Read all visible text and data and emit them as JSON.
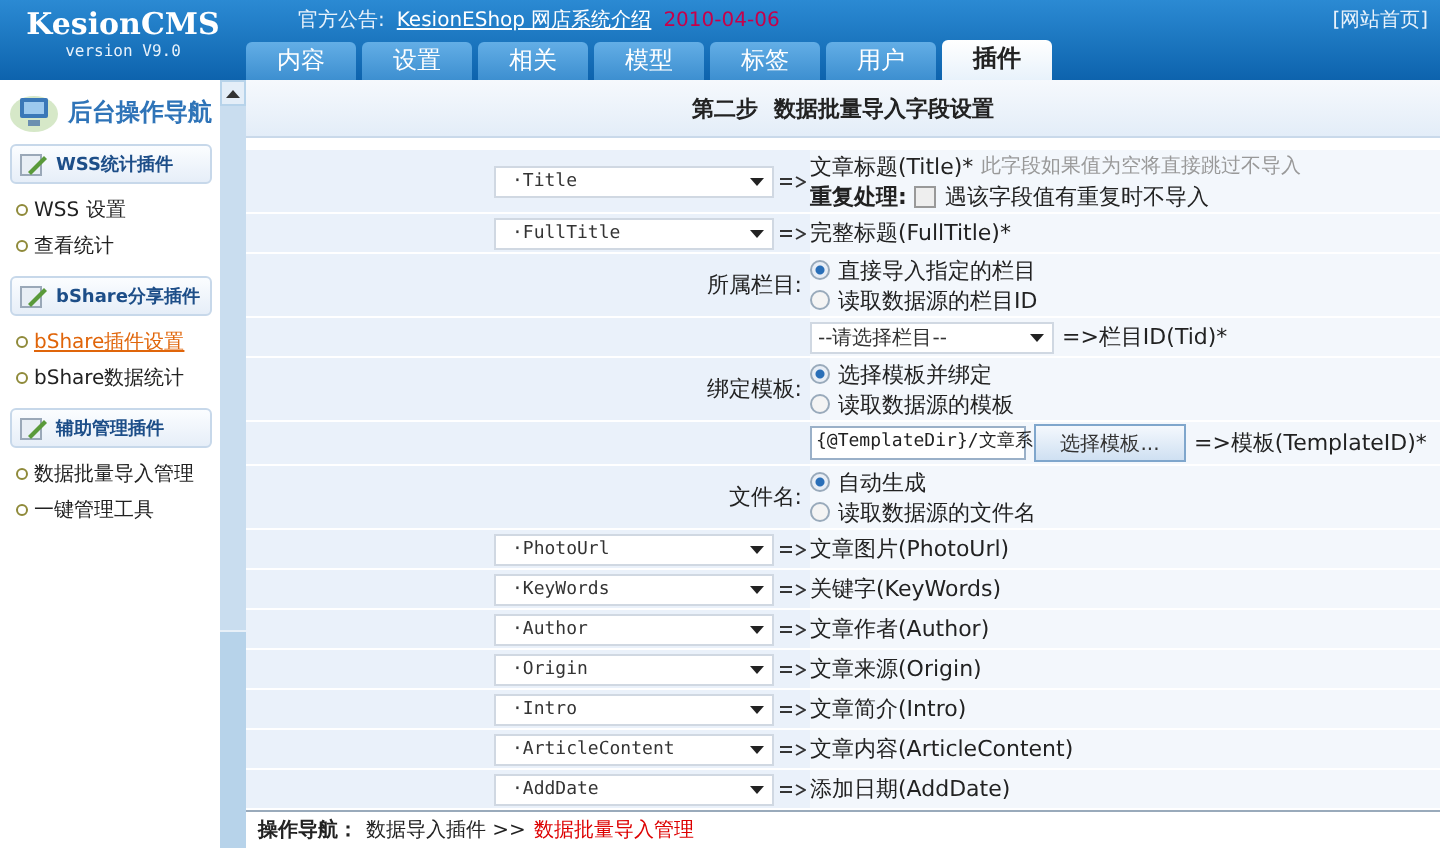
{
  "header": {
    "logo": "KesionCMS",
    "version": "version V9.0",
    "notice_label": "官方公告:",
    "notice_link": "KesionEShop 网店系统介绍",
    "notice_date": "2010-04-06",
    "top_link": "[网站首页]"
  },
  "tabs": [
    {
      "label": "内容",
      "selected": false
    },
    {
      "label": "设置",
      "selected": false
    },
    {
      "label": "相关",
      "selected": false
    },
    {
      "label": "模型",
      "selected": false
    },
    {
      "label": "标签",
      "selected": false
    },
    {
      "label": "用户",
      "selected": false
    },
    {
      "label": "插件",
      "selected": true
    }
  ],
  "sidebar": {
    "title": "后台操作导航",
    "groups": [
      {
        "title": "WSS统计插件",
        "items": [
          {
            "label": "WSS 设置",
            "selected": false
          },
          {
            "label": "查看统计",
            "selected": false
          }
        ]
      },
      {
        "title": "bShare分享插件",
        "items": [
          {
            "label": "bShare插件设置",
            "selected": true
          },
          {
            "label": "bShare数据统计",
            "selected": false
          }
        ]
      },
      {
        "title": "辅助管理插件",
        "items": [
          {
            "label": "数据批量导入管理",
            "selected": false
          },
          {
            "label": "一键管理工具",
            "selected": false
          }
        ]
      }
    ]
  },
  "step_title": "第二步  数据批量导入字段设置",
  "rows": [
    {
      "kind": "field_map",
      "field": "·Title",
      "target": "文章标题(Title)*",
      "note": "此字段如果值为空将直接跳过不导入",
      "extra": {
        "label": "重复处理:",
        "checkbox_label": "遇该字段值有重复时不导入",
        "checked": false
      }
    },
    {
      "kind": "field_map",
      "field": "·FullTitle",
      "target": "完整标题(FullTitle)*"
    },
    {
      "kind": "radio",
      "label": "所属栏目:",
      "options": [
        {
          "label": "直接导入指定的栏目",
          "selected": true
        },
        {
          "label": "读取数据源的栏目ID",
          "selected": false
        }
      ]
    },
    {
      "kind": "select",
      "value": "--请选择栏目--",
      "target": "=>栏目ID(Tid)*"
    },
    {
      "kind": "radio",
      "label": "绑定模板:",
      "options": [
        {
          "label": "选择模板并绑定",
          "selected": true
        },
        {
          "label": "读取数据源的模板",
          "selected": false
        }
      ]
    },
    {
      "kind": "template",
      "value": "{@TemplateDir}/文章系",
      "button": "选择模板...",
      "target": "=>模板(TemplateID)*"
    },
    {
      "kind": "radio",
      "label": "文件名:",
      "options": [
        {
          "label": "自动生成",
          "selected": true
        },
        {
          "label": "读取数据源的文件名",
          "selected": false
        }
      ]
    },
    {
      "kind": "field_map",
      "field": "·PhotoUrl",
      "target": "文章图片(PhotoUrl)"
    },
    {
      "kind": "field_map",
      "field": "·KeyWords",
      "target": "关键字(KeyWords)"
    },
    {
      "kind": "field_map",
      "field": "·Author",
      "target": "文章作者(Author)"
    },
    {
      "kind": "field_map",
      "field": "·Origin",
      "target": "文章来源(Origin)"
    },
    {
      "kind": "field_map",
      "field": "·Intro",
      "target": "文章简介(Intro)"
    },
    {
      "kind": "field_map",
      "field": "·ArticleContent",
      "target": "文章内容(ArticleContent)"
    },
    {
      "kind": "field_map",
      "field": "·AddDate",
      "target": "添加日期(AddDate)"
    }
  ],
  "breadcrumb": {
    "label": "操作导航：",
    "path": "数据导入插件 >>",
    "current": "数据批量导入管理"
  }
}
